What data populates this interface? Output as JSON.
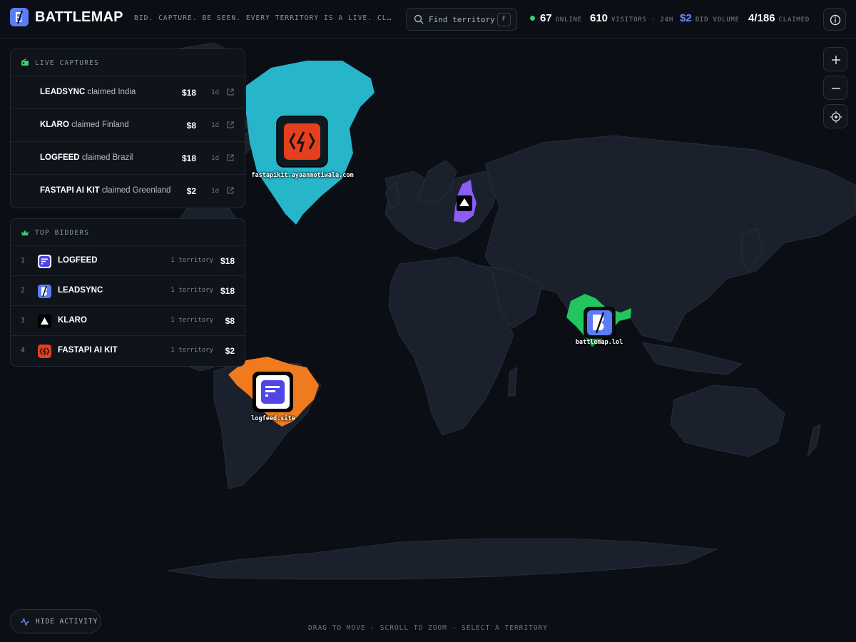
{
  "app": {
    "name": "BATTLEMAP",
    "tagline": "BID. CAPTURE. BE SEEN. EVERY TERRITORY IS A LIVE. CLICK-TR…"
  },
  "search": {
    "placeholder": "Find territory",
    "shortcut": "F"
  },
  "stats": {
    "online": {
      "value": "67",
      "label": "ONLINE"
    },
    "visitors": {
      "value": "610",
      "label": "VISITORS · 24H"
    },
    "bid_volume": {
      "value": "$2",
      "label": "BID VOLUME"
    },
    "claimed": {
      "value": "4/186",
      "label": "CLAIMED"
    }
  },
  "colors": {
    "accent": "#5b7cf5",
    "online_dot": "#3ecf6a",
    "greenland": "#26b5c9",
    "finland": "#8b5cf6",
    "india": "#22c55e",
    "brazil": "#f07b1e"
  },
  "live_captures": {
    "title": "LIVE CAPTURES",
    "items": [
      {
        "name": "LEADSYNC",
        "action": "claimed",
        "country": "India",
        "amount": "$18",
        "time": "1d"
      },
      {
        "name": "KLARO",
        "action": "claimed",
        "country": "Finland",
        "amount": "$8",
        "time": "1d"
      },
      {
        "name": "LOGFEED",
        "action": "claimed",
        "country": "Brazil",
        "amount": "$18",
        "time": "1d"
      },
      {
        "name": "FASTAPI AI KIT",
        "action": "claimed",
        "country": "Greenland",
        "amount": "$2",
        "time": "1d"
      }
    ]
  },
  "top_bidders": {
    "title": "TOP BIDDERS",
    "items": [
      {
        "rank": "1",
        "name": "LOGFEED",
        "count": "1 territory",
        "amount": "$18",
        "logo": "logfeed-logo-icon"
      },
      {
        "rank": "2",
        "name": "LEADSYNC",
        "count": "1 territory",
        "amount": "$18",
        "logo": "leadsync-logo-icon"
      },
      {
        "rank": "3",
        "name": "KLARO",
        "count": "1 territory",
        "amount": "$8",
        "logo": "klaro-logo-icon"
      },
      {
        "rank": "4",
        "name": "FASTAPI AI KIT",
        "count": "1 territory",
        "amount": "$2",
        "logo": "fastapi-logo-icon"
      }
    ]
  },
  "markers": {
    "greenland": "fastapikit.ayaanmotiwala.com",
    "india": "battlemap.lol",
    "brazil": "logfeed.site"
  },
  "footer": {
    "hide_activity": "HIDE ACTIVITY",
    "hint": "DRAG TO MOVE · SCROLL TO ZOOM · SELECT A TERRITORY"
  }
}
